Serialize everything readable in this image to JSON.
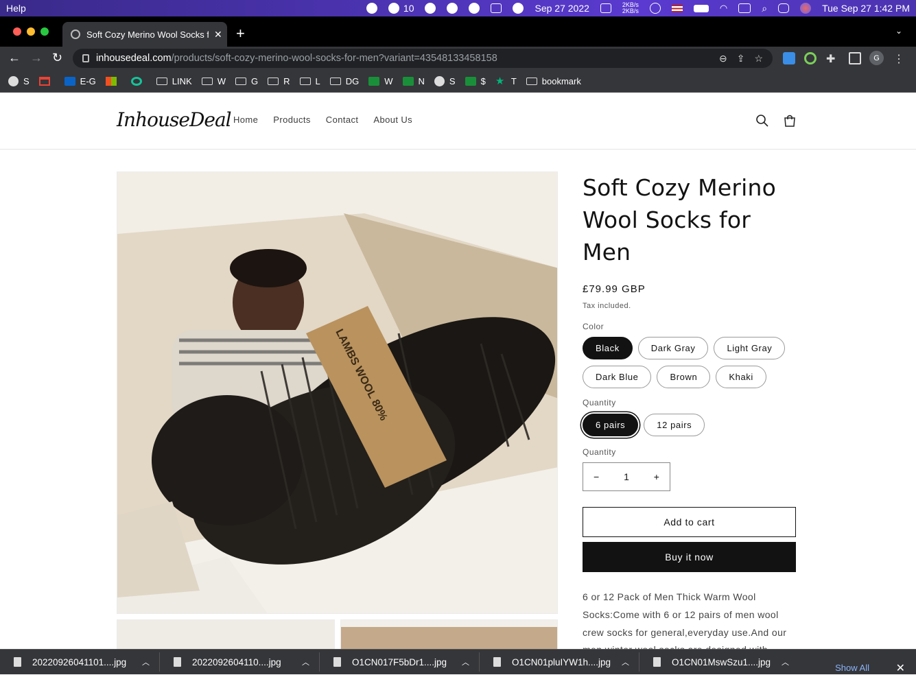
{
  "menubar": {
    "app_menu": "Help",
    "wechat_count": "10",
    "date": "Sep 27 2022",
    "net_up": "2KB/s",
    "net_down": "2KB/s",
    "clock": "Tue Sep 27  1:42 PM"
  },
  "browser": {
    "tab_title": "Soft Cozy Merino Wool Socks for Men",
    "url_host": "inhousedeal.com",
    "url_path": "/products/soft-cozy-merino-wool-socks-for-men?variant=43548133458158",
    "profile_initial": "G",
    "bookmarks": [
      "S",
      "",
      "E-G",
      "",
      "",
      "LINK",
      "W",
      "G",
      "R",
      "L",
      "DG",
      "W",
      "N",
      "S",
      "$",
      "T",
      "bookmark"
    ]
  },
  "site": {
    "logo": "InhouseDeal",
    "nav": [
      "Home",
      "Products",
      "Contact",
      "About Us"
    ]
  },
  "product": {
    "title": "Soft Cozy Merino Wool Socks for Men",
    "price": "£79.99 GBP",
    "tax_note": "Tax included.",
    "color_label": "Color",
    "colors": [
      "Black",
      "Dark Gray",
      "Light Gray",
      "Dark Blue",
      "Brown",
      "Khaki"
    ],
    "selected_color": "Black",
    "pack_label": "Quantity",
    "packs": [
      "6 pairs",
      "12 pairs"
    ],
    "selected_pack": "6 pairs",
    "qty_label": "Quantity",
    "qty_value": "1",
    "qty_minus": "−",
    "qty_plus": "+",
    "add_to_cart": "Add to cart",
    "buy_now": "Buy it now",
    "description": "6 or 12 Pack of Men Thick Warm Wool Socks:Come with 6 or 12 pairs of men wool crew socks for general,everyday use.And our men winter wool socks are designed with vintage stripes.Each pair of wool crew socks with a",
    "band_text": "LAMBS WOOL 80%"
  },
  "downloads": {
    "files": [
      "20220926041101....jpg",
      "2022092604110....jpg",
      "O1CN017F5bDr1....jpg",
      "O1CN01pluIYW1h....jpg",
      "O1CN01MswSzu1....jpg"
    ],
    "show_all": "Show All"
  }
}
